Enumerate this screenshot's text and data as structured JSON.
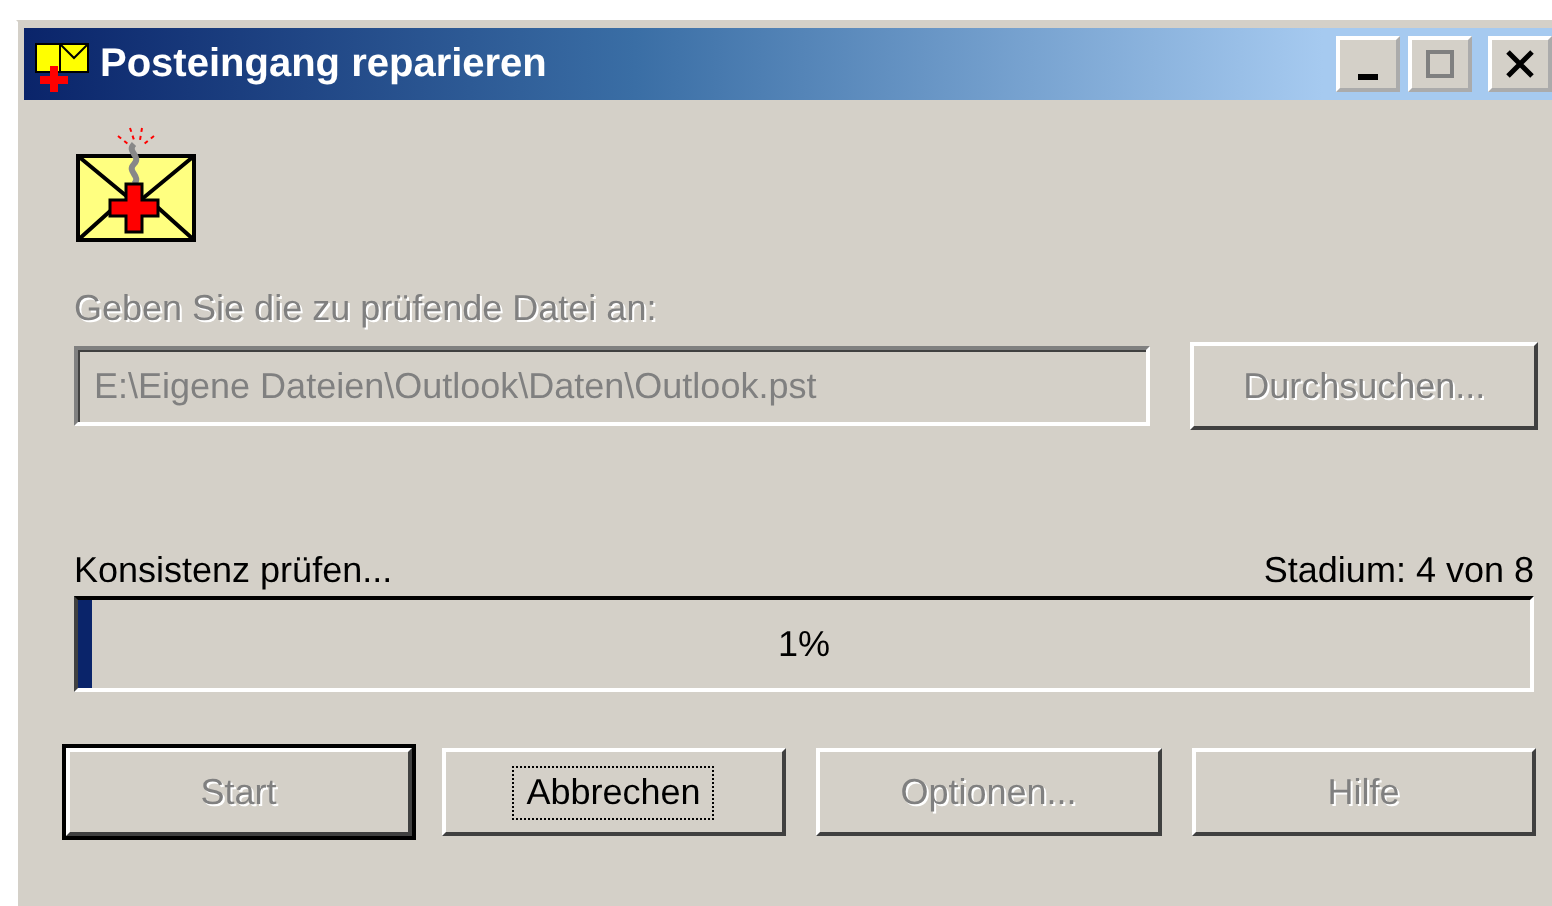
{
  "window": {
    "title": "Posteingang reparieren"
  },
  "title_buttons": [
    {
      "kind": "minimize"
    },
    {
      "kind": "maximize"
    },
    {
      "kind": "close"
    }
  ],
  "file_label": {
    "text": "Geben Sie die zu prüfende Datei an:",
    "disabled": true
  },
  "file_field": {
    "value": "E:\\Eigene Dateien\\Outlook\\Daten\\Outlook.pst",
    "disabled": true
  },
  "browse_button": {
    "label": "Durchsuchen...",
    "disabled": true,
    "default": false,
    "focused": false
  },
  "progress": {
    "status": "Konsistenz prüfen...",
    "stage": "Stadium: 4 von 8",
    "percent": "1%",
    "level": 0.01
  },
  "buttons": [
    {
      "label": "Start",
      "disabled": true,
      "default": true,
      "focused": false
    },
    {
      "label": "Abbrechen",
      "disabled": false,
      "default": false,
      "focused": true
    },
    {
      "label": "Optionen...",
      "disabled": true,
      "default": false,
      "focused": false
    },
    {
      "label": "Hilfe",
      "disabled": true,
      "default": false,
      "focused": false
    }
  ]
}
